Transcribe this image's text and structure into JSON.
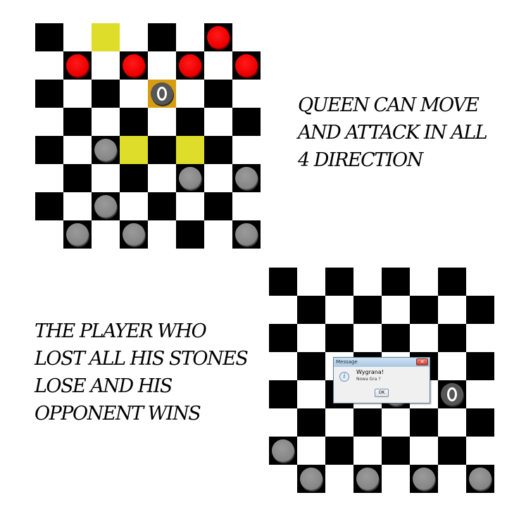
{
  "caption_top": "QUEEN CAN MOVE\nAND ATTACK IN ALL\n4 DIRECTION",
  "caption_bottom": "THE PLAYER WHO\nLOST ALL HIS STONES\nLOSE AND HIS\nOPPONENT WINS",
  "board1": {
    "highlight_squares": [
      [
        2,
        0
      ],
      [
        3,
        4
      ],
      [
        5,
        4
      ]
    ],
    "selected_square": [
      4,
      2
    ],
    "pieces": [
      {
        "color": "red",
        "col": 6,
        "row": 0
      },
      {
        "color": "red",
        "col": 1,
        "row": 1
      },
      {
        "color": "red",
        "col": 3,
        "row": 1
      },
      {
        "color": "red",
        "col": 5,
        "row": 1
      },
      {
        "color": "red",
        "col": 7,
        "row": 1
      },
      {
        "color": "gray-queen",
        "col": 4,
        "row": 2
      },
      {
        "color": "gray",
        "col": 2,
        "row": 4
      },
      {
        "color": "gray",
        "col": 5,
        "row": 5
      },
      {
        "color": "gray",
        "col": 7,
        "row": 5
      },
      {
        "color": "gray",
        "col": 2,
        "row": 6
      },
      {
        "color": "gray",
        "col": 1,
        "row": 7
      },
      {
        "color": "gray",
        "col": 3,
        "row": 7
      },
      {
        "color": "gray",
        "col": 7,
        "row": 7
      }
    ]
  },
  "board2": {
    "highlight_squares": [],
    "pieces": [
      {
        "color": "gray",
        "col": 4,
        "row": 4
      },
      {
        "color": "gray-queen",
        "col": 6,
        "row": 4
      },
      {
        "color": "gray",
        "col": 0,
        "row": 6
      },
      {
        "color": "gray",
        "col": 1,
        "row": 7
      },
      {
        "color": "gray",
        "col": 3,
        "row": 7
      },
      {
        "color": "gray",
        "col": 5,
        "row": 7
      },
      {
        "color": "gray",
        "col": 7,
        "row": 7
      }
    ]
  },
  "dialog": {
    "title": "Message",
    "close_label": "✕",
    "icon_glyph": "i",
    "message": "Wygrana!",
    "sub_message": "Nowa Gra ?",
    "ok_label": "OK"
  },
  "colors": {
    "dark_square": "#000000",
    "light_square": "#ffffff",
    "highlight": "#dede2a",
    "selected": "#d89c10",
    "red_piece": "#ee0000",
    "gray_piece": "#888888",
    "queen_piece": "#565656"
  }
}
